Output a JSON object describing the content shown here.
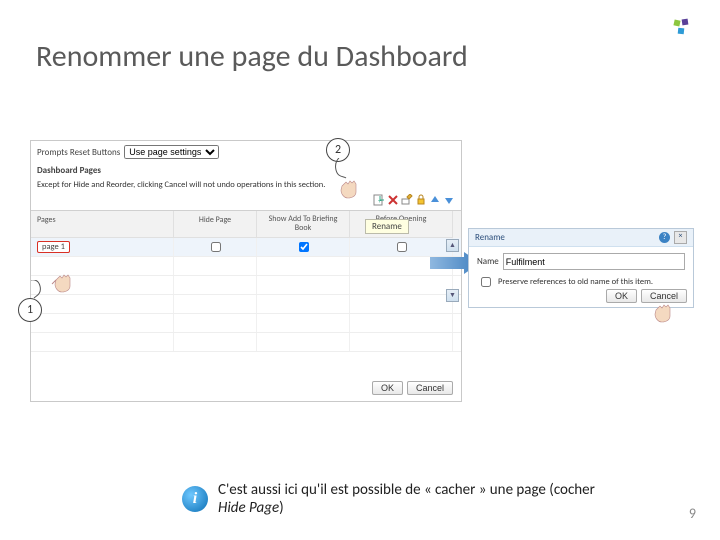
{
  "title": "Renommer une page du Dashboard",
  "pagenum": "9",
  "panel": {
    "prompts_label": "Prompts Reset Buttons",
    "prompts_value": "Use page settings",
    "dash_pages_heading": "Dashboard Pages",
    "note": "Except for Hide and Reorder, clicking Cancel will not undo operations in this section.",
    "rename_tooltip": "Rename",
    "cols": {
      "pages": "Pages",
      "hide": "Hide Page",
      "bb": "Show Add To Briefing Book",
      "bn": "Before Opening"
    },
    "row_page_label": "page 1",
    "ok": "OK",
    "cancel": "Cancel"
  },
  "rename": {
    "title": "Rename",
    "name_label": "Name",
    "name_value": "Fulfilment",
    "preserve": "Preserve references to old name of this item.",
    "ok": "OK",
    "cancel": "Cancel"
  },
  "callouts": {
    "one": "1",
    "two": "2"
  },
  "tip": {
    "text_before": "C'est aussi ici qu'il est possible de « cacher » une page (cocher ",
    "text_em": "Hide Page",
    "text_after": ")"
  }
}
